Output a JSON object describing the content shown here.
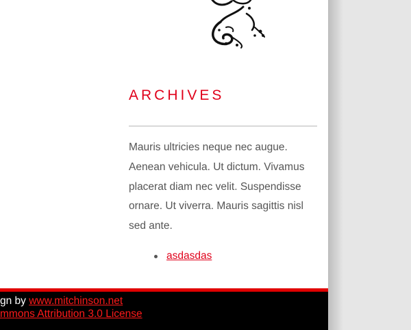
{
  "sidebar": {
    "ornament_icon": "decorative-swirl-icon",
    "heading": "ARCHIVES",
    "paragraph": "Mauris ultricies neque nec augue. Aenean vehicula. Ut dictum. Vivamus placerat diam nec velit. Suspendisse ornare. Ut viverra. Mauris sagittis nisl sed ante.",
    "archive_links": [
      {
        "label": "asdasdas"
      }
    ]
  },
  "footer": {
    "design_prefix": "gn by ",
    "design_link": "www.mitchinson.net",
    "license_link": "mmons Attribution 3.0 License"
  },
  "colors": {
    "accent": "#e0001a",
    "footer_bg": "#000000",
    "footer_border": "#e00000",
    "body_text": "#555555"
  }
}
